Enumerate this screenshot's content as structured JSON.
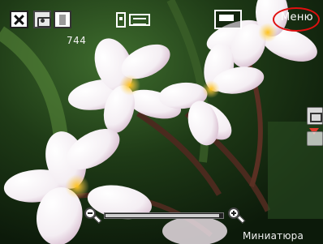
{
  "counter": "744",
  "menu": {
    "label": "Меню"
  },
  "bottom": {
    "thumbnail_label": "Миниатюра"
  },
  "zoom": {
    "level": 0.97
  },
  "icons": {
    "close": "close-icon",
    "camera_mode": "camera-icon",
    "format": "format-icon",
    "storage": "memory-card-icon",
    "resolution": "resolution-icon",
    "side_camera": "camera-icon",
    "side_video": "video-icon",
    "zoom_out": "zoom-out-icon",
    "zoom_in": "zoom-in-icon"
  },
  "colors": {
    "menu_highlight": "#e01010",
    "side_arrow": "#e23c30"
  }
}
